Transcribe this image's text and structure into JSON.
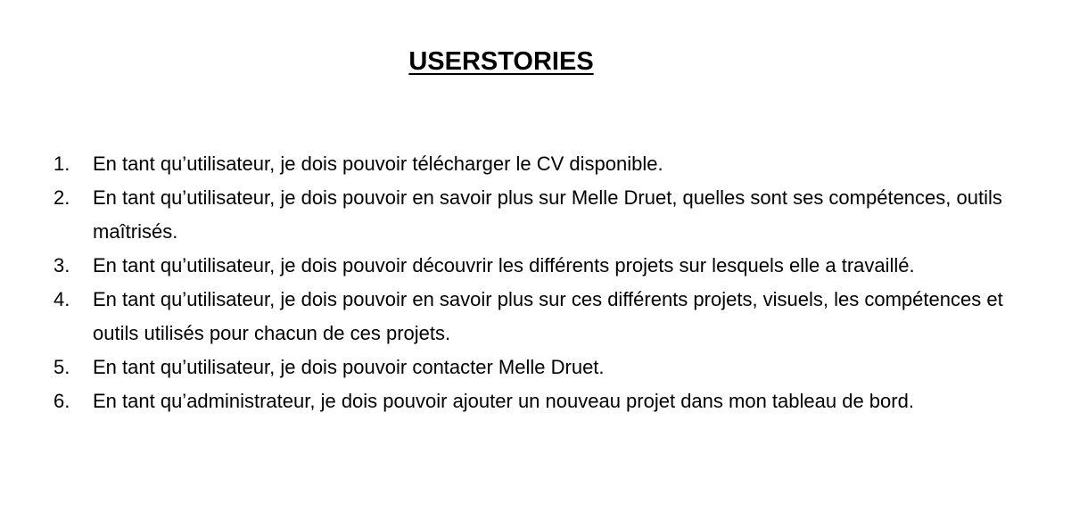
{
  "document": {
    "title": "USERSTORIES",
    "stories": [
      {
        "number": "1.",
        "text": "En tant qu’utilisateur, je dois pouvoir télécharger le CV disponible."
      },
      {
        "number": "2.",
        "text": "En tant qu’utilisateur, je dois pouvoir en savoir plus sur Melle Druet, quelles sont ses compétences, outils maîtrisés."
      },
      {
        "number": "3.",
        "text": "En tant qu’utilisateur, je dois pouvoir découvrir les différents projets sur lesquels elle a travaillé."
      },
      {
        "number": "4.",
        "text": "En tant qu’utilisateur, je dois pouvoir en savoir plus sur ces différents projets, visuels, les compétences et outils utilisés pour chacun de ces projets."
      },
      {
        "number": "5.",
        "text": "En tant qu’utilisateur, je dois pouvoir contacter Melle Druet."
      },
      {
        "number": "6.",
        "text": "En tant qu’administrateur, je dois pouvoir ajouter un nouveau projet dans mon tableau de bord."
      }
    ]
  }
}
